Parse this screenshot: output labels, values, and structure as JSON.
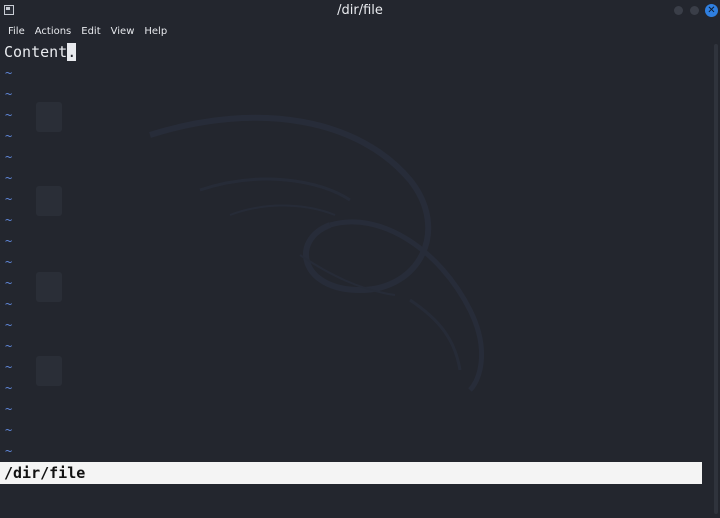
{
  "window": {
    "title": "/dir/file"
  },
  "menu": {
    "items": [
      "File",
      "Actions",
      "Edit",
      "View",
      "Help"
    ]
  },
  "editor": {
    "first_line_text": "Content",
    "cursor_char": ".",
    "empty_line_marker": "~",
    "status_text": "/dir/file"
  },
  "colors": {
    "background": "#23262e",
    "tilde": "#5f86d8",
    "statusline_bg": "#f4f4f4",
    "close_button": "#2f7fe0"
  }
}
